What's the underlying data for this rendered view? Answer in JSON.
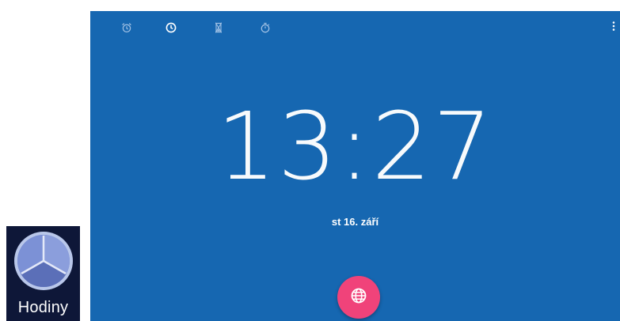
{
  "launcher": {
    "label": "Hodiny",
    "icon": "clock-app-icon"
  },
  "clock": {
    "time": "13:27",
    "date": "st 16. září"
  },
  "tabs": [
    {
      "name": "alarm",
      "icon": "alarm-icon",
      "selected": false
    },
    {
      "name": "clock",
      "icon": "clock-icon",
      "selected": true
    },
    {
      "name": "timer",
      "icon": "hourglass-icon",
      "selected": false
    },
    {
      "name": "stopwatch",
      "icon": "stopwatch-icon",
      "selected": false
    }
  ],
  "fab": {
    "icon": "globe-icon"
  },
  "overflow_menu": {
    "icon": "more-vert-icon"
  },
  "colors": {
    "screen_background": "#1667b1",
    "fab": "#f0437a",
    "launcher_background": "#0e1738",
    "tab_inactive": "#9fc0e4",
    "tab_active": "#ffffff"
  }
}
